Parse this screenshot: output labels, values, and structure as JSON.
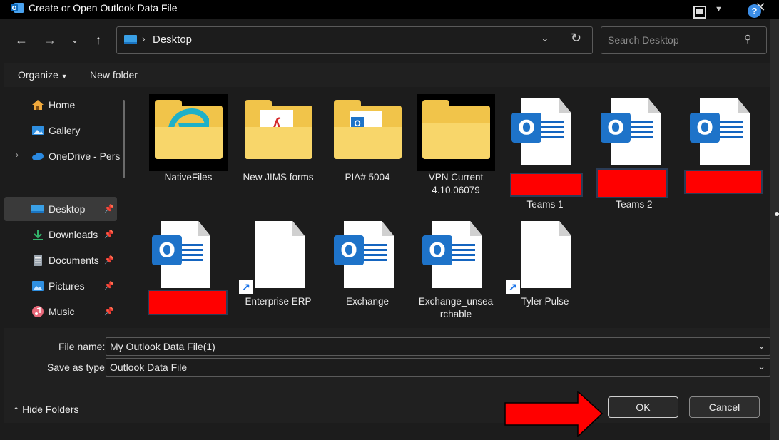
{
  "window": {
    "title": "Create or Open Outlook Data File",
    "app_icon": "outlook-icon",
    "close_icon": "close-icon"
  },
  "nav": {
    "back_icon": "arrow-left-icon",
    "forward_icon": "arrow-right-icon",
    "recent_icon": "chevron-down-icon",
    "up_icon": "arrow-up-icon"
  },
  "address": {
    "location": "Desktop",
    "separator": "›",
    "refresh_icon": "refresh-icon"
  },
  "search": {
    "placeholder": "Search Desktop",
    "icon": "search-icon"
  },
  "command_bar": {
    "organize": "Organize",
    "new_folder": "New folder",
    "help": "?"
  },
  "sidebar": {
    "items": [
      {
        "label": "Home",
        "icon": "home-icon",
        "pinned": false
      },
      {
        "label": "Gallery",
        "icon": "gallery-icon",
        "pinned": false
      },
      {
        "label": "OneDrive - Perso",
        "icon": "cloud-icon",
        "pinned": false
      },
      {
        "label": "Desktop",
        "icon": "desktop-icon",
        "pinned": true,
        "selected": true
      },
      {
        "label": "Downloads",
        "icon": "download-icon",
        "pinned": true
      },
      {
        "label": "Documents",
        "icon": "document-icon",
        "pinned": true
      },
      {
        "label": "Pictures",
        "icon": "pictures-icon",
        "pinned": true
      },
      {
        "label": "Music",
        "icon": "music-icon",
        "pinned": true
      }
    ]
  },
  "files": [
    {
      "name": "NativeFiles",
      "type": "folder"
    },
    {
      "name": "New JIMS forms",
      "type": "folder"
    },
    {
      "name": "PIA# 5004",
      "type": "folder"
    },
    {
      "name": "VPN Current 4.10.06079",
      "type": "folder"
    },
    {
      "name": "Teams 1",
      "type": "outlook-file",
      "redacted": true
    },
    {
      "name": "Teams 2",
      "type": "outlook-file",
      "redacted": true
    },
    {
      "name": "",
      "type": "outlook-file",
      "redacted": true
    },
    {
      "name": "",
      "type": "outlook-file",
      "redacted": true
    },
    {
      "name": "Enterprise ERP",
      "type": "shortcut"
    },
    {
      "name": "Exchange",
      "type": "outlook-file"
    },
    {
      "name": "Exchange_unsearchable",
      "type": "outlook-file"
    },
    {
      "name": "Tyler Pulse",
      "type": "shortcut"
    }
  ],
  "form": {
    "file_name_label": "File name:",
    "file_name_value": "My Outlook Data File(1)",
    "save_type_label": "Save as type:",
    "save_type_value": "Outlook Data File"
  },
  "footer": {
    "hide_folders": "Hide Folders",
    "ok": "OK",
    "cancel": "Cancel"
  },
  "colors": {
    "annotation_arrow": "#ff0000",
    "redaction": "#ff0000",
    "outlook_blue": "#1e73c9",
    "folder_yellow": "#f1c44a"
  }
}
